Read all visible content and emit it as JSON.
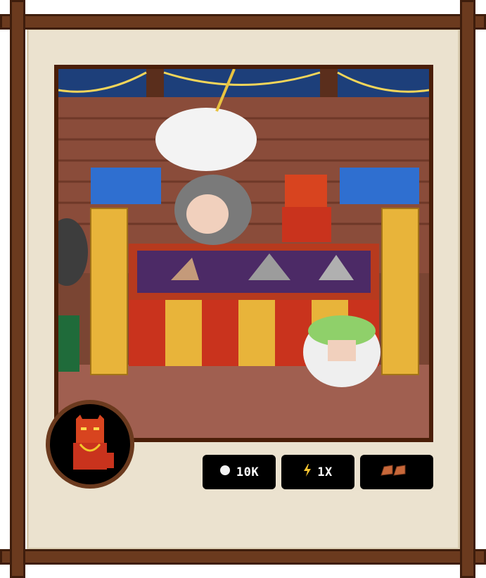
{
  "stats": {
    "coins": {
      "icon": "coin-icon",
      "value": "10K"
    },
    "multiplier": {
      "icon": "lightning-icon",
      "value": "1X"
    },
    "bricks": {
      "icon": "bricks-icon",
      "value": ""
    }
  },
  "avatar": {
    "icon": "red-demon-cat-icon"
  },
  "scene": {
    "description_icon": "carnival-booth-scene"
  }
}
